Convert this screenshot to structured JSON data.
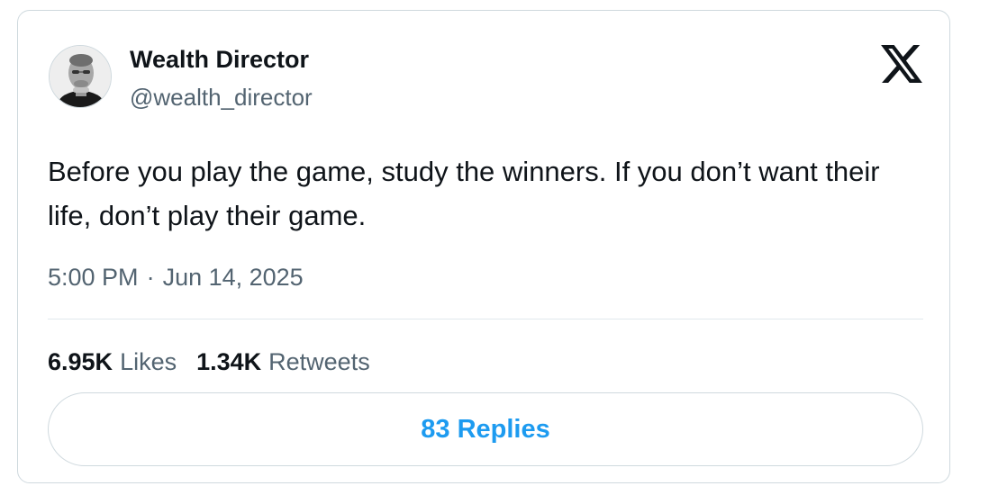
{
  "tweet": {
    "author_name": "Wealth Director",
    "author_handle": "@wealth_director",
    "text": "Before you play the game, study the winners. If you don’t want their life, don’t play their game.",
    "time": "5:00 PM",
    "separator": "·",
    "date": "Jun 14, 2025",
    "likes_count": "6.95K",
    "likes_label": "Likes",
    "retweets_count": "1.34K",
    "retweets_label": "Retweets",
    "replies_label": "83 Replies"
  },
  "icons": {
    "platform": "x-logo-icon",
    "avatar": "avatar-photo"
  },
  "colors": {
    "text_primary": "#0f1419",
    "text_secondary": "#536471",
    "link_blue": "#1d9bf0",
    "border": "#cfd9de"
  }
}
